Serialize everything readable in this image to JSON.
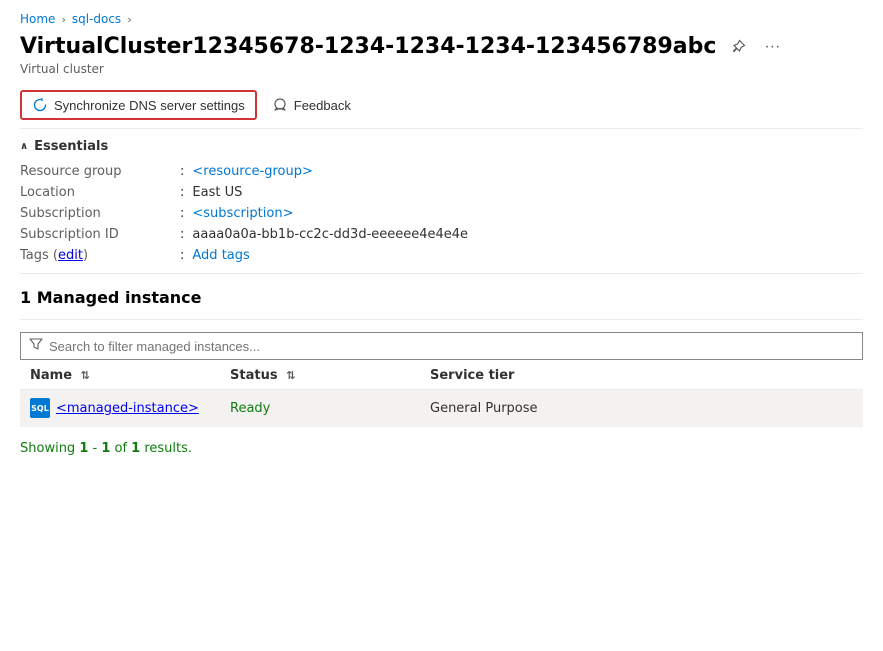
{
  "breadcrumb": {
    "home": "Home",
    "sql_docs": "sql-docs",
    "sep": "›"
  },
  "header": {
    "title": "VirtualCluster12345678-1234-1234-1234-123456789abc",
    "subtitle": "Virtual cluster",
    "pin_icon": "⌖",
    "more_icon": "···"
  },
  "toolbar": {
    "sync_label": "Synchronize DNS server settings",
    "feedback_label": "Feedback"
  },
  "essentials": {
    "section_label": "Essentials",
    "fields": [
      {
        "label": "Resource group",
        "value": "<resource-group>",
        "link": true
      },
      {
        "label": "Location",
        "value": "East US",
        "link": false
      },
      {
        "label": "Subscription",
        "value": "<subscription>",
        "link": true
      },
      {
        "label": "Subscription ID",
        "value": "aaaa0a0a-bb1b-cc2c-dd3d-eeeeee4e4e4e",
        "link": false
      },
      {
        "label": "Tags (edit)",
        "value": "Add tags",
        "link": true
      }
    ]
  },
  "managed_instances": {
    "title": "1 Managed instance",
    "search_placeholder": "Search to filter managed instances...",
    "columns": [
      {
        "label": "Name",
        "sortable": true
      },
      {
        "label": "Status",
        "sortable": true
      },
      {
        "label": "Service tier",
        "sortable": false
      }
    ],
    "rows": [
      {
        "name": "<managed-instance>",
        "status": "Ready",
        "service_tier": "General Purpose"
      }
    ],
    "results_text": "Showing 1 - 1 of 1 results."
  }
}
